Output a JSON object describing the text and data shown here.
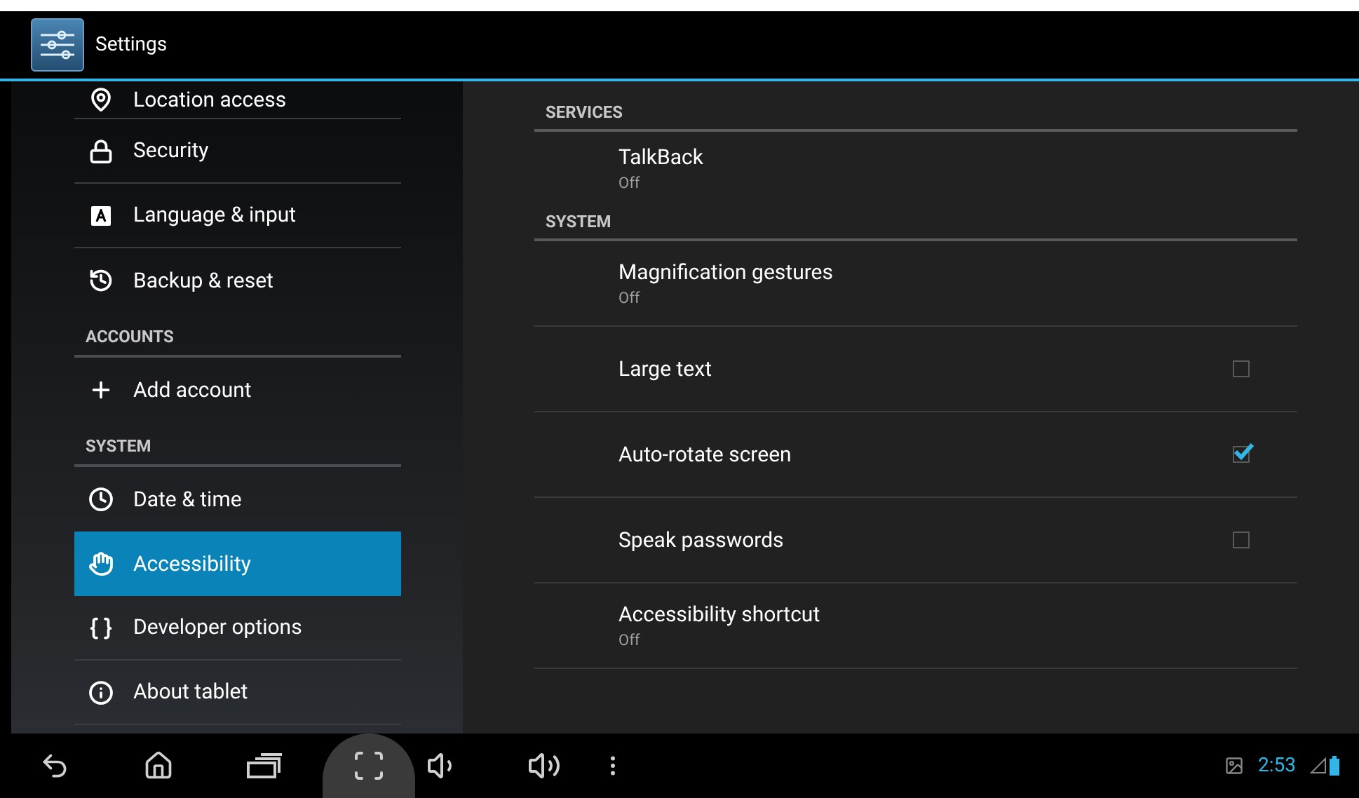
{
  "action_bar": {
    "title": "Settings"
  },
  "sidebar": {
    "items": [
      {
        "kind": "item",
        "label": "Location access",
        "selected": false
      },
      {
        "kind": "item",
        "label": "Security",
        "selected": false
      },
      {
        "kind": "item",
        "label": "Language & input",
        "selected": false
      },
      {
        "kind": "item",
        "label": "Backup & reset",
        "selected": false
      },
      {
        "kind": "header",
        "label": "ACCOUNTS"
      },
      {
        "kind": "item",
        "label": "Add account",
        "selected": false
      },
      {
        "kind": "header",
        "label": "SYSTEM"
      },
      {
        "kind": "item",
        "label": "Date & time",
        "selected": false
      },
      {
        "kind": "item",
        "label": "Accessibility",
        "selected": true
      },
      {
        "kind": "item",
        "label": "Developer options",
        "selected": false
      },
      {
        "kind": "item",
        "label": "About tablet",
        "selected": false
      }
    ]
  },
  "content": {
    "items": [
      {
        "kind": "header",
        "label": "SERVICES"
      },
      {
        "kind": "summary",
        "title": "TalkBack",
        "summary": "Off"
      },
      {
        "kind": "header",
        "label": "SYSTEM"
      },
      {
        "kind": "summary",
        "title": "Magnification gestures",
        "summary": "Off"
      },
      {
        "kind": "checkbox",
        "title": "Large text",
        "checked": false
      },
      {
        "kind": "checkbox",
        "title": "Auto-rotate screen",
        "checked": true
      },
      {
        "kind": "checkbox",
        "title": "Speak passwords",
        "checked": false
      },
      {
        "kind": "summary",
        "title": "Accessibility shortcut",
        "summary": "Off"
      }
    ]
  },
  "status_bar": {
    "time": "2:53"
  }
}
